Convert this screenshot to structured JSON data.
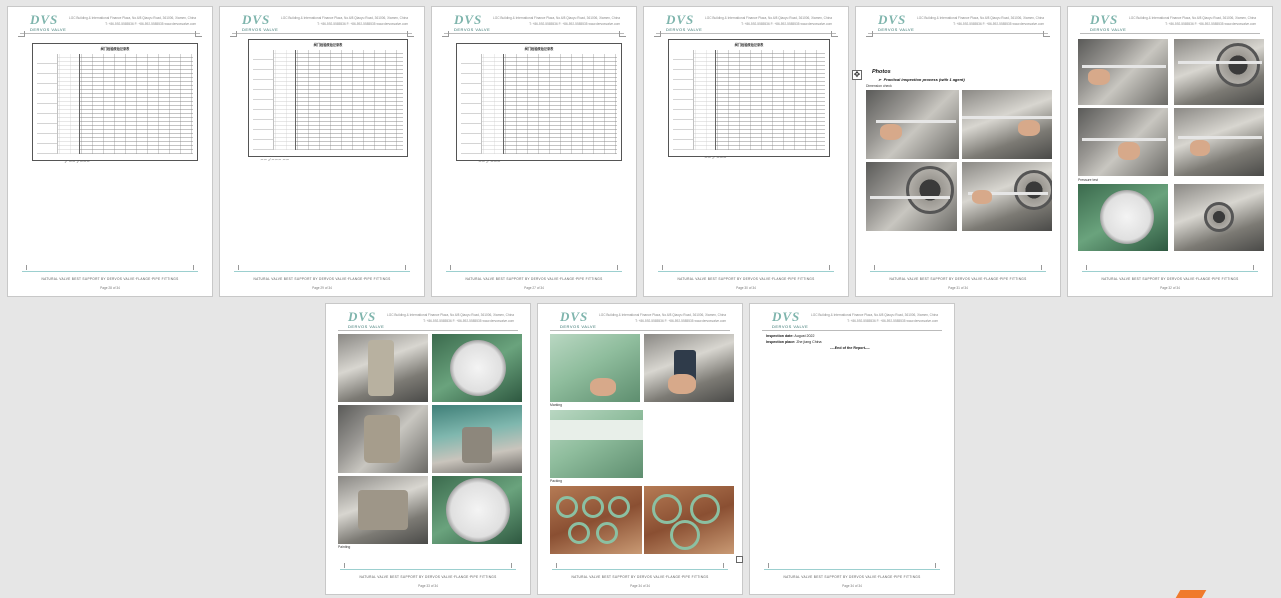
{
  "header": {
    "logo": "DVS",
    "logo_sub": "DERVOS VALVE",
    "address_line1": "LGC Building & International Finance Plaza, No.6/8 Qiaoyu Road, 361006, Xiamen, China",
    "address_line2": "T: +86-592-5585536    F: +86-592-5585535    www.dervosvalve.com"
  },
  "footer": {
    "text": "NATURAL VALVE BEST SUPPORT BY DERVOS VALVE·FLANGE·PIPE FITTINGS"
  },
  "pages": [
    {
      "page_label": "Page 28 of 34"
    },
    {
      "page_label": "Page 29 of 34"
    },
    {
      "page_label": "Page 27 of 34"
    },
    {
      "page_label": "Page 30 of 34"
    },
    {
      "page_label": "Page 31 of 34"
    },
    {
      "page_label": "Page 32 of 34"
    },
    {
      "page_label": "Page 33 of 34"
    },
    {
      "page_label": "Page 34 of 34"
    },
    {
      "page_label": "Page 34 of 34"
    }
  ],
  "sheet": {
    "title": "阀门检验原始记录表",
    "subtitle": "Check Record of Valve Inspection"
  },
  "photos_page": {
    "heading": "Photos",
    "bullet": "Practical inspection process (with 1 agent)",
    "caption_dimension": "Dimension check",
    "caption_pressure": "Pressure test",
    "caption_painting": "Painting",
    "caption_marking": "Marking",
    "caption_packing": "Packing"
  },
  "final_page": {
    "label_date": "Inspection date:",
    "value_date": "August    2022",
    "label_place": "Inspection place:",
    "value_place": "Zhe jiang  China",
    "end": "----End of the Report----"
  }
}
